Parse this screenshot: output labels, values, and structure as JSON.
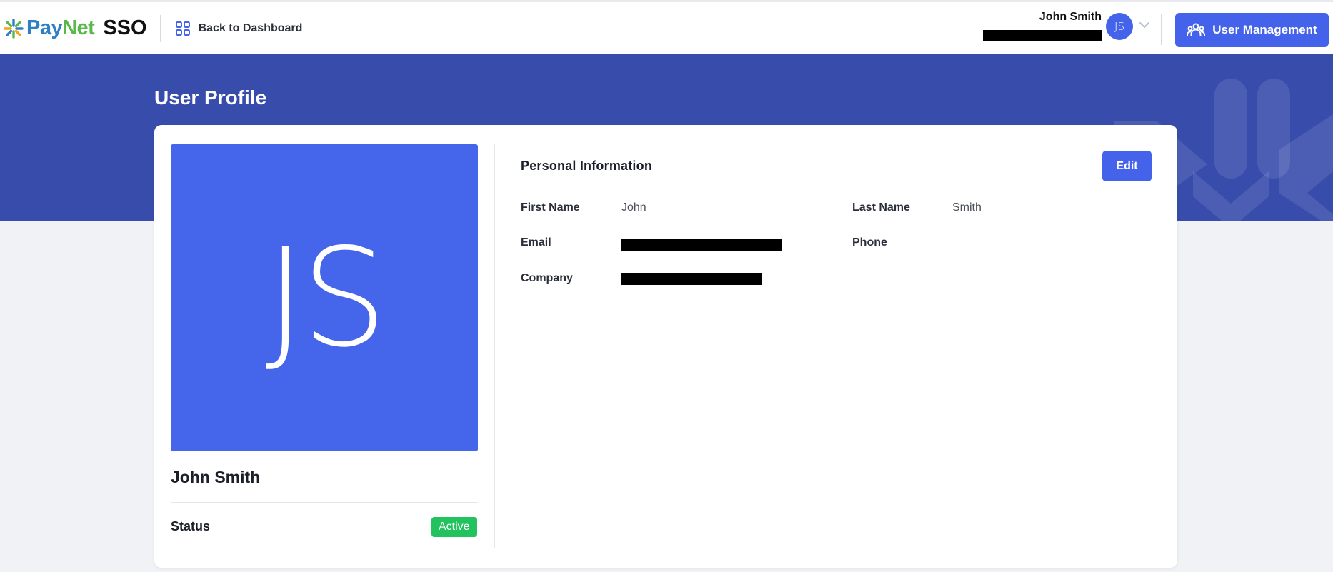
{
  "header": {
    "brand": {
      "pay": "Pay",
      "net": "Net",
      "sso": "SSO"
    },
    "back_label": "Back to Dashboard",
    "user_name": "John Smith",
    "user_initials": "JS",
    "user_management_label": "User Management"
  },
  "page": {
    "title": "User Profile"
  },
  "profile": {
    "initials": "JS",
    "name": "John Smith",
    "status_label": "Status",
    "status_value": "Active"
  },
  "personal_info": {
    "title": "Personal Information",
    "edit_label": "Edit",
    "fields": {
      "first_name": {
        "label": "First Name",
        "value": "John"
      },
      "last_name": {
        "label": "Last Name",
        "value": "Smith"
      },
      "email": {
        "label": "Email"
      },
      "phone": {
        "label": "Phone",
        "value": ""
      },
      "company": {
        "label": "Company"
      }
    }
  },
  "colors": {
    "accent": "#4463ea",
    "banner": "#384cab",
    "status_active": "#22c25e"
  },
  "icons": [
    "paynet-logo-icon",
    "grid-icon",
    "chevron-down-icon",
    "users-icon"
  ]
}
